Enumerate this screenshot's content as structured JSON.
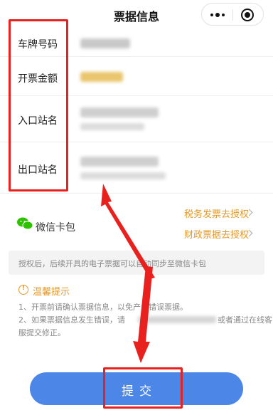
{
  "nav": {
    "title": "票据信息",
    "more_icon": "more-dots-icon",
    "close_icon": "mini-program-close-icon"
  },
  "ticket": {
    "plate_label": "车牌号码",
    "amount_label": "开票金额",
    "entry_label": "入口站名",
    "exit_label": "出口站名"
  },
  "wallet": {
    "label": "微信卡包",
    "icon": "wechat-card-icon",
    "tax_link": "税务发票去授权",
    "finance_link": "财政票据去授权"
  },
  "tip": "授权后，后续开具的电子票据可以自动同步至微信卡包",
  "notice": {
    "title": "温馨提示",
    "lines": [
      "1、开票前请确认票据信息，以免产生错误票据。",
      "2、如果票据信息发生错误，请",
      "或者通过在线客",
      "服提交修正。"
    ]
  },
  "submit_label": "提交",
  "colors": {
    "accent_orange": "#e59a2b",
    "submit_blue": "#4c86e7",
    "annotation_red": "#e8211f"
  }
}
